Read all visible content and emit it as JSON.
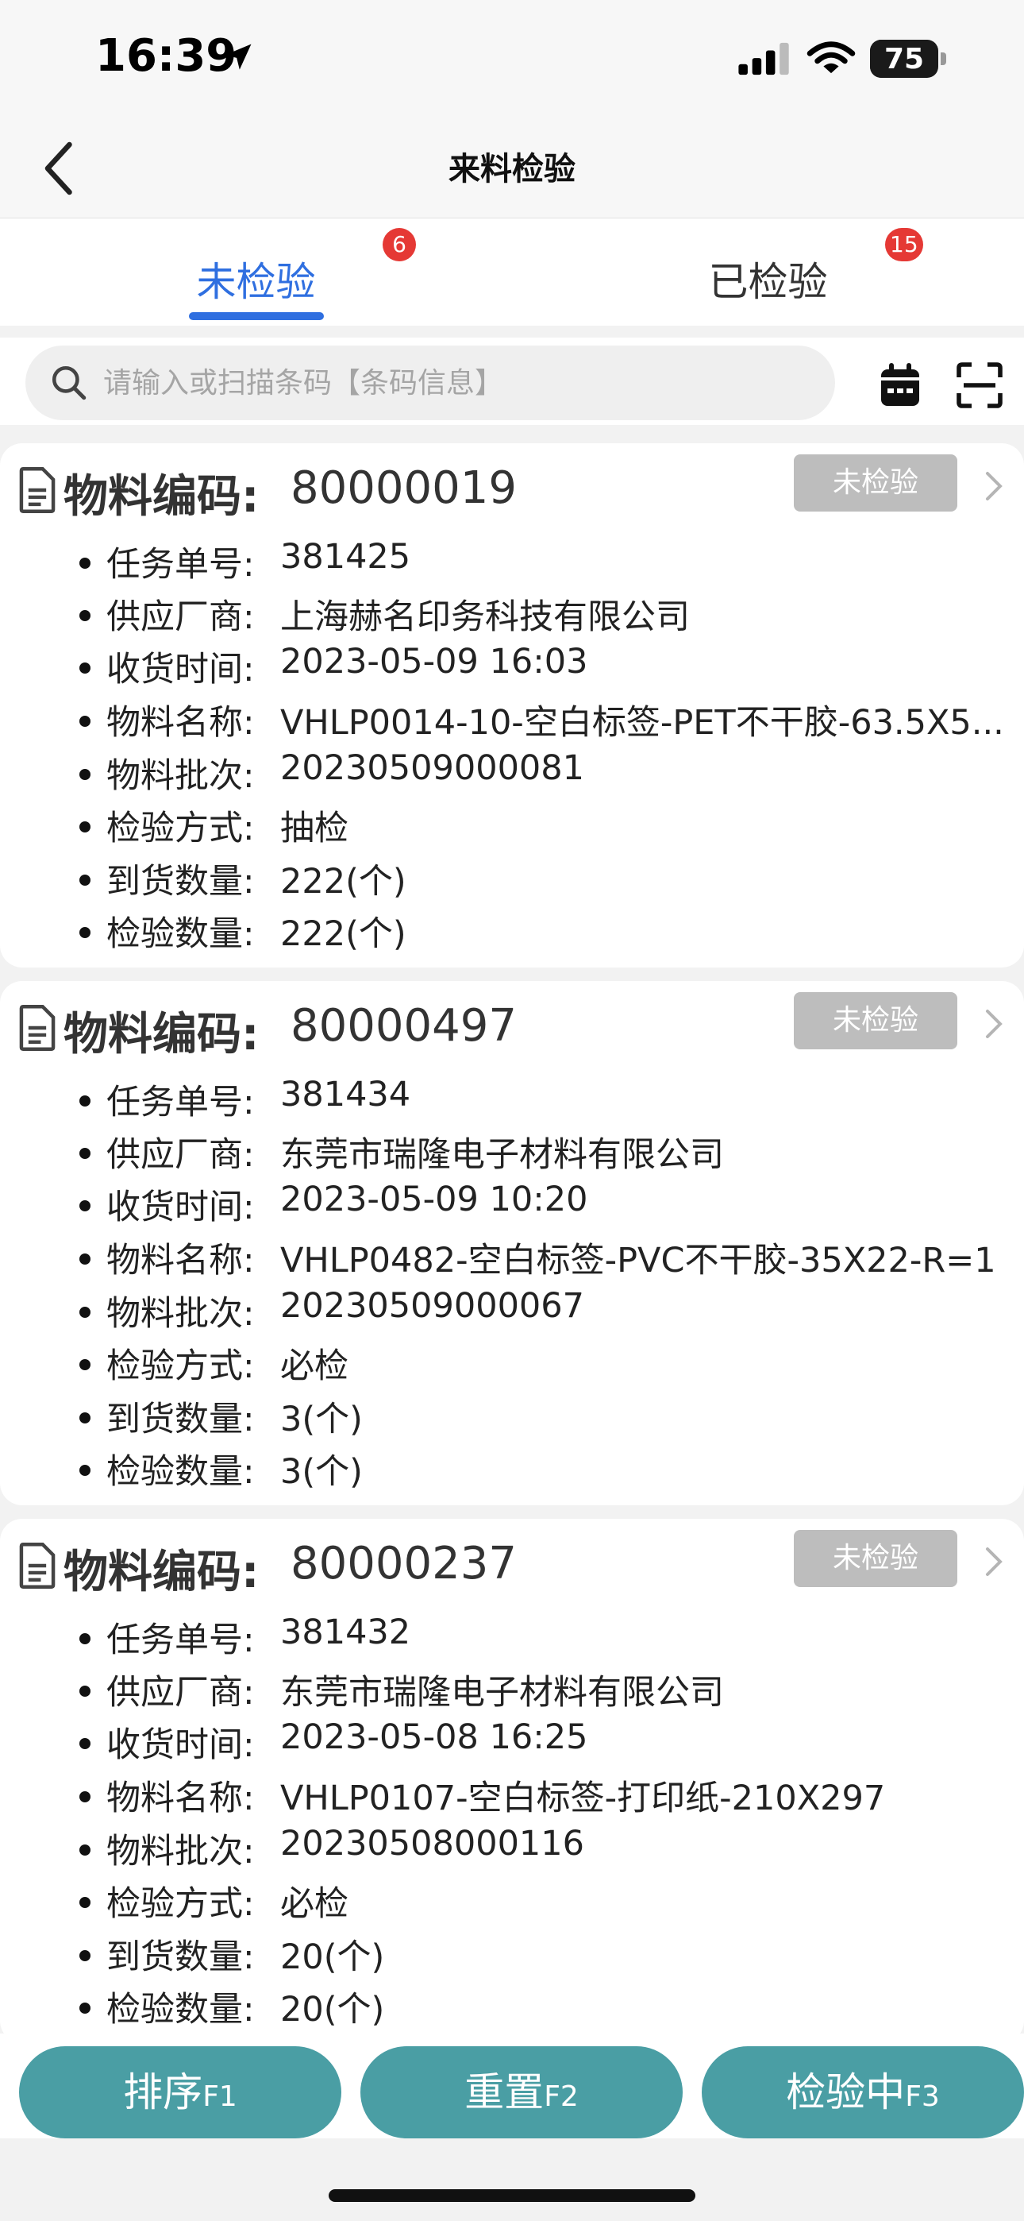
{
  "status_bar": {
    "time": "16:39",
    "battery": "75",
    "battery_level": 0.75
  },
  "nav": {
    "title": "来料检验"
  },
  "tabs": [
    {
      "label": "未检验",
      "badge": "6",
      "active": true
    },
    {
      "label": "已检验",
      "badge": "15",
      "active": false
    }
  ],
  "search": {
    "placeholder": "请输入或扫描条码【条码信息】",
    "value": ""
  },
  "cards": [
    {
      "code_label": "物料编码:",
      "code": "80000019",
      "status": "未检验",
      "fields": [
        {
          "label": "任务单号:",
          "value": "381425"
        },
        {
          "label": "供应厂商:",
          "value": "上海赫名印务科技有限公司"
        },
        {
          "label": "收货时间:",
          "value": "2023-05-09 16:03"
        },
        {
          "label": "物料名称:",
          "value": "VHLP0014-10-空白标签-PET不干胶-63.5X5..."
        },
        {
          "label": "物料批次:",
          "value": "20230509000081"
        },
        {
          "label": "检验方式:",
          "value": "抽检"
        },
        {
          "label": "到货数量:",
          "value": "222(个)"
        },
        {
          "label": "检验数量:",
          "value": "222(个)"
        }
      ]
    },
    {
      "code_label": "物料编码:",
      "code": "80000497",
      "status": "未检验",
      "fields": [
        {
          "label": "任务单号:",
          "value": "381434"
        },
        {
          "label": "供应厂商:",
          "value": "东莞市瑞隆电子材料有限公司"
        },
        {
          "label": "收货时间:",
          "value": "2023-05-09 10:20"
        },
        {
          "label": "物料名称:",
          "value": "VHLP0482-空白标签-PVC不干胶-35X22-R=1"
        },
        {
          "label": "物料批次:",
          "value": "20230509000067"
        },
        {
          "label": "检验方式:",
          "value": "必检"
        },
        {
          "label": "到货数量:",
          "value": "3(个)"
        },
        {
          "label": "检验数量:",
          "value": "3(个)"
        }
      ]
    },
    {
      "code_label": "物料编码:",
      "code": "80000237",
      "status": "未检验",
      "fields": [
        {
          "label": "任务单号:",
          "value": "381432"
        },
        {
          "label": "供应厂商:",
          "value": "东莞市瑞隆电子材料有限公司"
        },
        {
          "label": "收货时间:",
          "value": "2023-05-08 16:25"
        },
        {
          "label": "物料名称:",
          "value": "VHLP0107-空白标签-打印纸-210X297"
        },
        {
          "label": "物料批次:",
          "value": "20230508000116"
        },
        {
          "label": "检验方式:",
          "value": "必检"
        },
        {
          "label": "到货数量:",
          "value": "20(个)"
        },
        {
          "label": "检验数量:",
          "value": "20(个)"
        }
      ]
    }
  ],
  "actions": [
    {
      "label": "排序",
      "key": "F1"
    },
    {
      "label": "重置",
      "key": "F2"
    },
    {
      "label": "检验中",
      "key": "F3"
    }
  ],
  "colors": {
    "accent": "#2f6fe0",
    "badge": "#e53935",
    "button": "#4a9ea4",
    "status_tag": "#bdbdbd"
  }
}
